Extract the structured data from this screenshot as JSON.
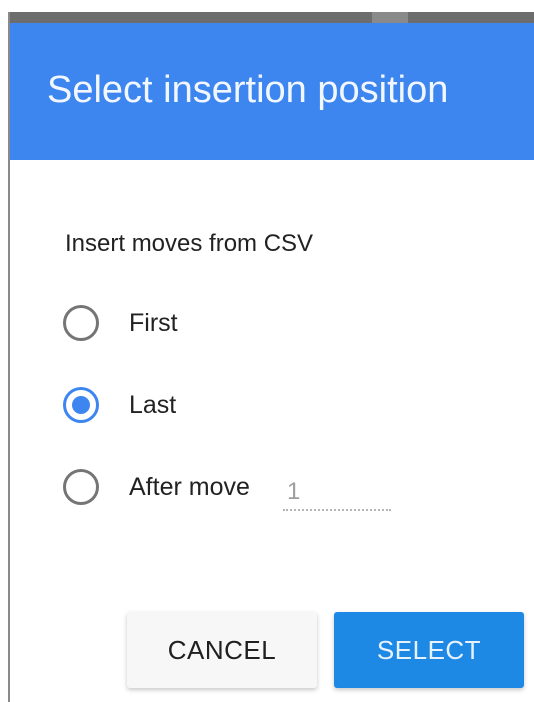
{
  "dialog": {
    "title": "Select insertion position",
    "subtitle": "Insert moves from CSV",
    "options": [
      {
        "label": "First",
        "checked": false
      },
      {
        "label": "Last",
        "checked": true
      },
      {
        "label": "After move",
        "checked": false
      }
    ],
    "after_move_input": {
      "placeholder": "1",
      "value": ""
    },
    "buttons": {
      "cancel": "CANCEL",
      "select": "SELECT"
    }
  },
  "colors": {
    "header_bg": "#3d86f0",
    "radio_checked": "#3d86f0",
    "select_button_bg": "#1e88e5",
    "cancel_button_bg": "#f7f7f7"
  }
}
